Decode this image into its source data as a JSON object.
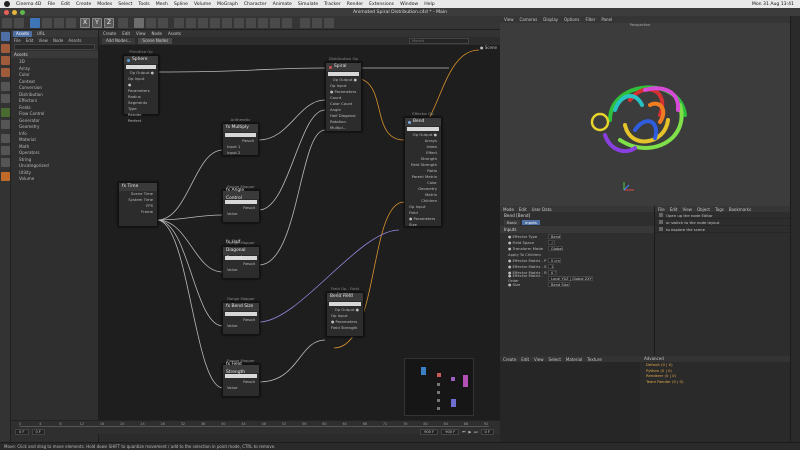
{
  "menubar": {
    "apple": "apple-icon",
    "items": [
      "Cinema 4D",
      "File",
      "Edit",
      "Create",
      "Modes",
      "Select",
      "Tools",
      "Mesh",
      "Spline",
      "Volume",
      "MoGraph",
      "Character",
      "Animate",
      "Simulate",
      "Tracker",
      "Render",
      "Extensions",
      "Window",
      "Help"
    ],
    "clock": "Mon 31 Aug  13:41"
  },
  "window": {
    "title": "Animated Spiral Distribution.c4d * - Main"
  },
  "toolbar": {
    "xyz_labels": [
      "X",
      "Y",
      "Z"
    ],
    "node_spaces": "Node Spaces",
    "layouts": "Layouts"
  },
  "assets": {
    "tabs": [
      "Assets",
      "URL"
    ],
    "menu": [
      "File",
      "Edit",
      "View",
      "Node",
      "Assets"
    ],
    "title": "Assets",
    "items": [
      "3D",
      "Array",
      "Color",
      "Context",
      "Conversion",
      "Distribution",
      "Effectors",
      "Fields",
      "Flow Control",
      "Generator",
      "Geometry",
      "Info",
      "Material",
      "Math",
      "Operators",
      "String",
      "Uncategorized",
      "Utility",
      "Volume"
    ]
  },
  "node_editor": {
    "menu": [
      "Create",
      "Edit",
      "View",
      "Node",
      "Assets"
    ],
    "tabs": [
      "Add Nodes...",
      "Scene Nodes"
    ],
    "search_placeholder": "Moved",
    "scene_out": "Scene",
    "nodes": {
      "sphere": {
        "caption": "Primitive Op",
        "title": "Sphere",
        "ports": [
          "Op Output ●",
          "Op Input",
          "● Parameters",
          "Radius",
          "Segments",
          "Type",
          "Render Perfect"
        ]
      },
      "multiply": {
        "caption": "Arithmetic",
        "title": "fx Multiply",
        "ports": [
          "Result",
          "Input 1",
          "Input 2"
        ]
      },
      "time": {
        "title": "fx Time",
        "ports": [
          "Scene Time",
          "System Time",
          "FPS",
          "Frame"
        ]
      },
      "angle": {
        "caption": "Range Mapper",
        "title": "fx Angle Control",
        "ports": [
          "Result",
          "Value"
        ]
      },
      "half": {
        "caption": "Range Mapper",
        "title": "fx Half Diagonal Control",
        "ports": [
          "Result",
          "Value"
        ]
      },
      "bend": {
        "caption": "Range Mapper",
        "title": "fx Bend Size",
        "ports": [
          "Result",
          "Value"
        ]
      },
      "fstr": {
        "caption": "Range Mapper",
        "title": "fx Field Strength",
        "ports": [
          "Result",
          "Value"
        ]
      },
      "spiral": {
        "caption": "Distribution Op",
        "title": "Spiral",
        "ports": [
          "Op Output ●",
          "Op Input",
          "● Parameters",
          "Count",
          "Color Count",
          "Angle",
          "Half Diagonal",
          "Rotation Multipl..."
        ]
      },
      "effector": {
        "caption": "Effector Op",
        "title": "Bend",
        "ports": [
          "Op Output ●",
          "Arrays",
          "Index",
          "Effect Strength",
          "Field Strength",
          "Ratio",
          "Parent Matrix",
          "Color",
          "Geometry",
          "Matrix",
          "Children",
          "Op Input",
          "Field",
          "● Parameters",
          "Size"
        ]
      },
      "bendfield": {
        "caption": "Field Op - Field Function",
        "title": "Bend Field",
        "ports": [
          "Op Output ●",
          "Op Input",
          "● Parameters",
          "Field Strength"
        ]
      }
    }
  },
  "viewport": {
    "menu": [
      "View",
      "Cameras",
      "Display",
      "Options",
      "Filter",
      "Panel"
    ],
    "label": "Perspective"
  },
  "attributes": {
    "menu": [
      "Mode",
      "Edit",
      "User Data"
    ],
    "object": "Bend [Bend]",
    "tabs": [
      "Basic",
      "Inputs"
    ],
    "section": "Inputs",
    "rows": [
      {
        "label": "● Effector Type",
        "value": "Bend"
      },
      {
        "label": "● Field Space",
        "value": "✓"
      },
      {
        "label": "● Transform Mode",
        "value": "Global"
      },
      {
        "label": "  Apply To Children",
        "value": ""
      },
      {
        "label": "● Effector Matrix . P",
        "value": "0 cm"
      },
      {
        "label": "● Effector Matrix . S",
        "value": "1"
      },
      {
        "label": "● Effector Matrix . R",
        "value": "0 °"
      },
      {
        "label": "● Effector Matrix . Order",
        "value": "Local YXZ | Global ZXY"
      },
      {
        "label": "● Size",
        "value": "Bend Size"
      }
    ]
  },
  "layers": {
    "menu": [
      "File",
      "Edit",
      "View",
      "Object",
      "Tags",
      "Bookmarks"
    ],
    "items": [
      "Open up the node Editor",
      "or switch to the node layout",
      "to explore the scene"
    ]
  },
  "materials": {
    "menu": [
      "Create",
      "Edit",
      "View",
      "Select",
      "Material",
      "Texture"
    ]
  },
  "console": {
    "title": "Advanced",
    "lines": [
      "Default (0 | 0)",
      "Python (0 | 0)",
      "Renderer (0 | 0)",
      "Team Render (0 | 0)"
    ]
  },
  "timeline": {
    "ruler_labels": [
      "0",
      "4",
      "8",
      "12",
      "16",
      "20",
      "24",
      "28",
      "32",
      "36",
      "40",
      "44",
      "48",
      "52",
      "56",
      "60",
      "64",
      "68",
      "72",
      "76",
      "80",
      "84",
      "88",
      "92"
    ],
    "start": "0 F",
    "end": "0 F",
    "max_a": "900 F",
    "max_b": "900 F",
    "current": "0 F"
  },
  "status": {
    "text": "Move: Click and drag to move elements. Hold down SHIFT to quantize movement / add to the selection in point mode, CTRL to remove."
  },
  "colors": {
    "accent": "#4e6fa3",
    "wire_orange": "#d8922e",
    "wire_grey": "#b9b9b9",
    "wire_violet": "#8f86d6"
  }
}
